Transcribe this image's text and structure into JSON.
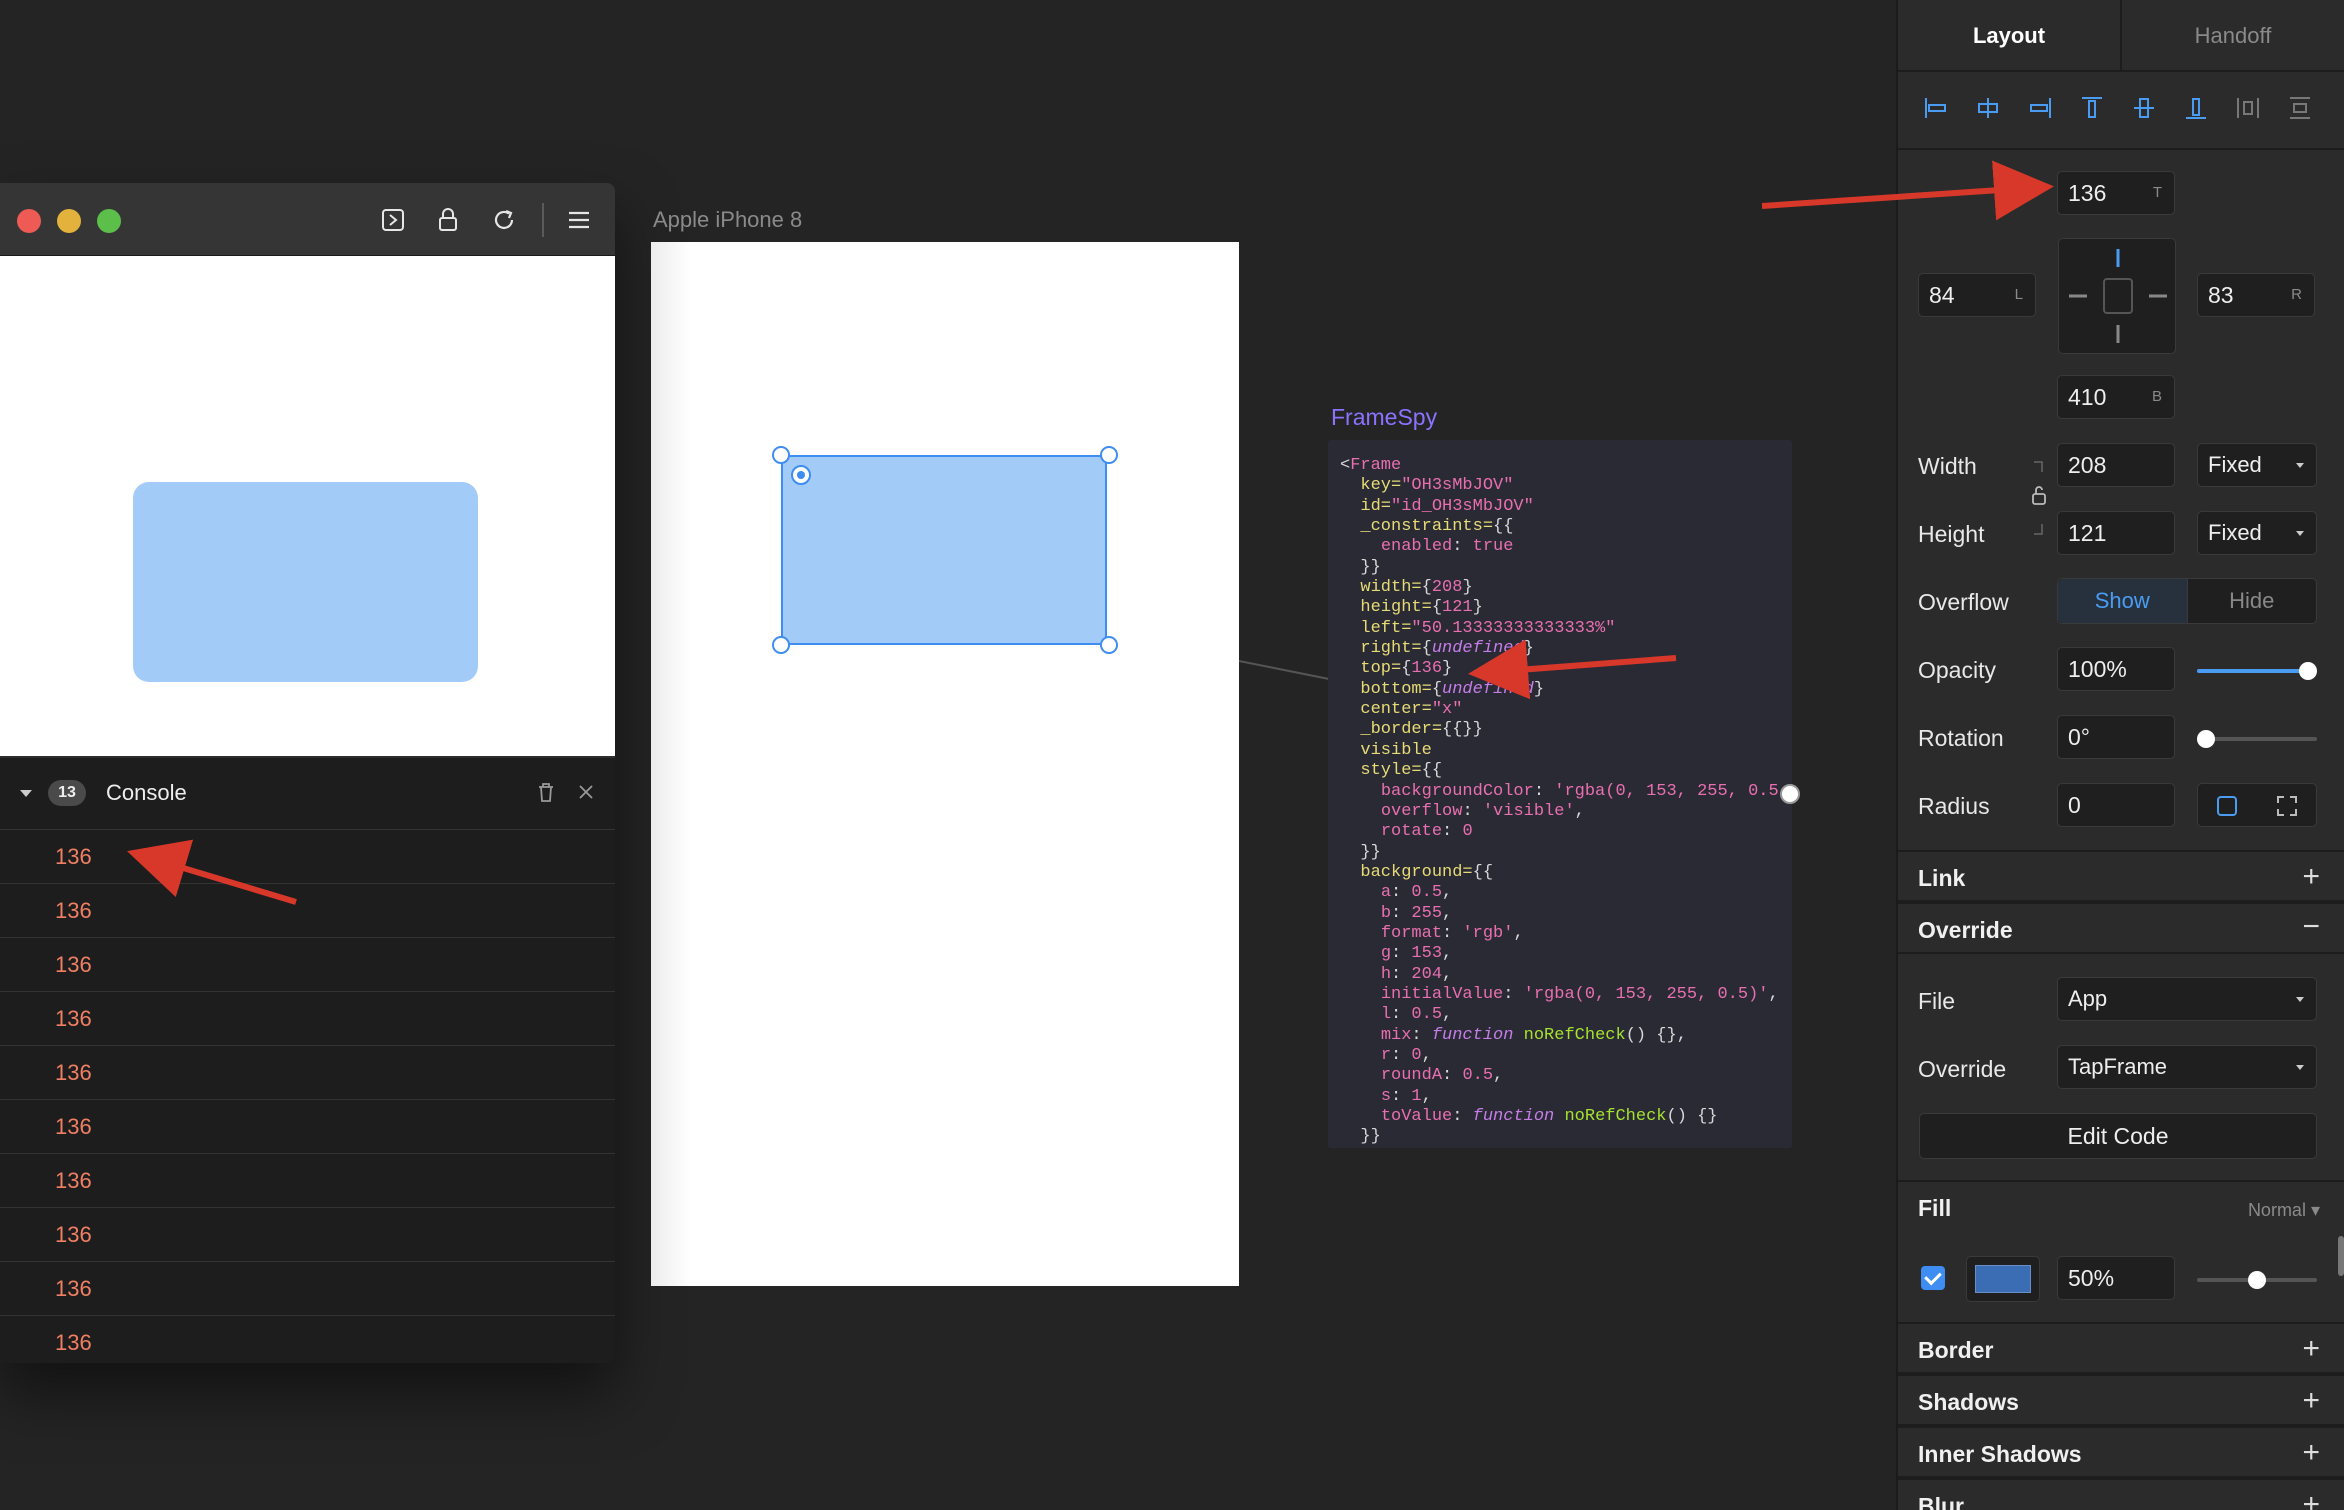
{
  "preview": {
    "console": {
      "badge_count": "13",
      "title": "Console",
      "logs": [
        "136",
        "136",
        "136",
        "136",
        "136",
        "136",
        "136",
        "136",
        "136",
        "136"
      ]
    }
  },
  "device": {
    "label": "Apple iPhone 8"
  },
  "framespy": {
    "title": "FrameSpy"
  },
  "panel": {
    "tabs": [
      "Layout",
      "Handoff"
    ],
    "top": {
      "value": "136",
      "suffix": "T"
    },
    "left": {
      "value": "84",
      "suffix": "L"
    },
    "right": {
      "value": "83",
      "suffix": "R"
    },
    "bottom": {
      "value": "410",
      "suffix": "B"
    },
    "width": {
      "label": "Width",
      "value": "208",
      "mode": "Fixed"
    },
    "height": {
      "label": "Height",
      "value": "121",
      "mode": "Fixed"
    },
    "overflow": {
      "label": "Overflow",
      "options": [
        "Show",
        "Hide"
      ],
      "selected": "Show"
    },
    "opacity": {
      "label": "Opacity",
      "value": "100%",
      "level": 1.0
    },
    "rotation": {
      "label": "Rotation",
      "value": "0°",
      "level": 0.0
    },
    "radius": {
      "label": "Radius",
      "value": "0"
    },
    "sections": {
      "link": "Link",
      "override": "Override",
      "fill": "Fill",
      "fill_mode": "Normal",
      "border": "Border",
      "shadows": "Shadows",
      "inner_shadows": "Inner Shadows",
      "blur": "Blur"
    },
    "file": {
      "label": "File",
      "value": "App"
    },
    "override_field": {
      "label": "Override",
      "value": "TapFrame"
    },
    "edit_code": "Edit Code",
    "fill": {
      "checked": true,
      "color": "#3a6db3",
      "opacity": "50%",
      "level": 0.5
    }
  },
  "colors": {
    "accent": "#3d8df2",
    "arrow": "#d7382a",
    "frame_fill": "#a3cbf8",
    "framespy_title": "#8b73ff"
  }
}
